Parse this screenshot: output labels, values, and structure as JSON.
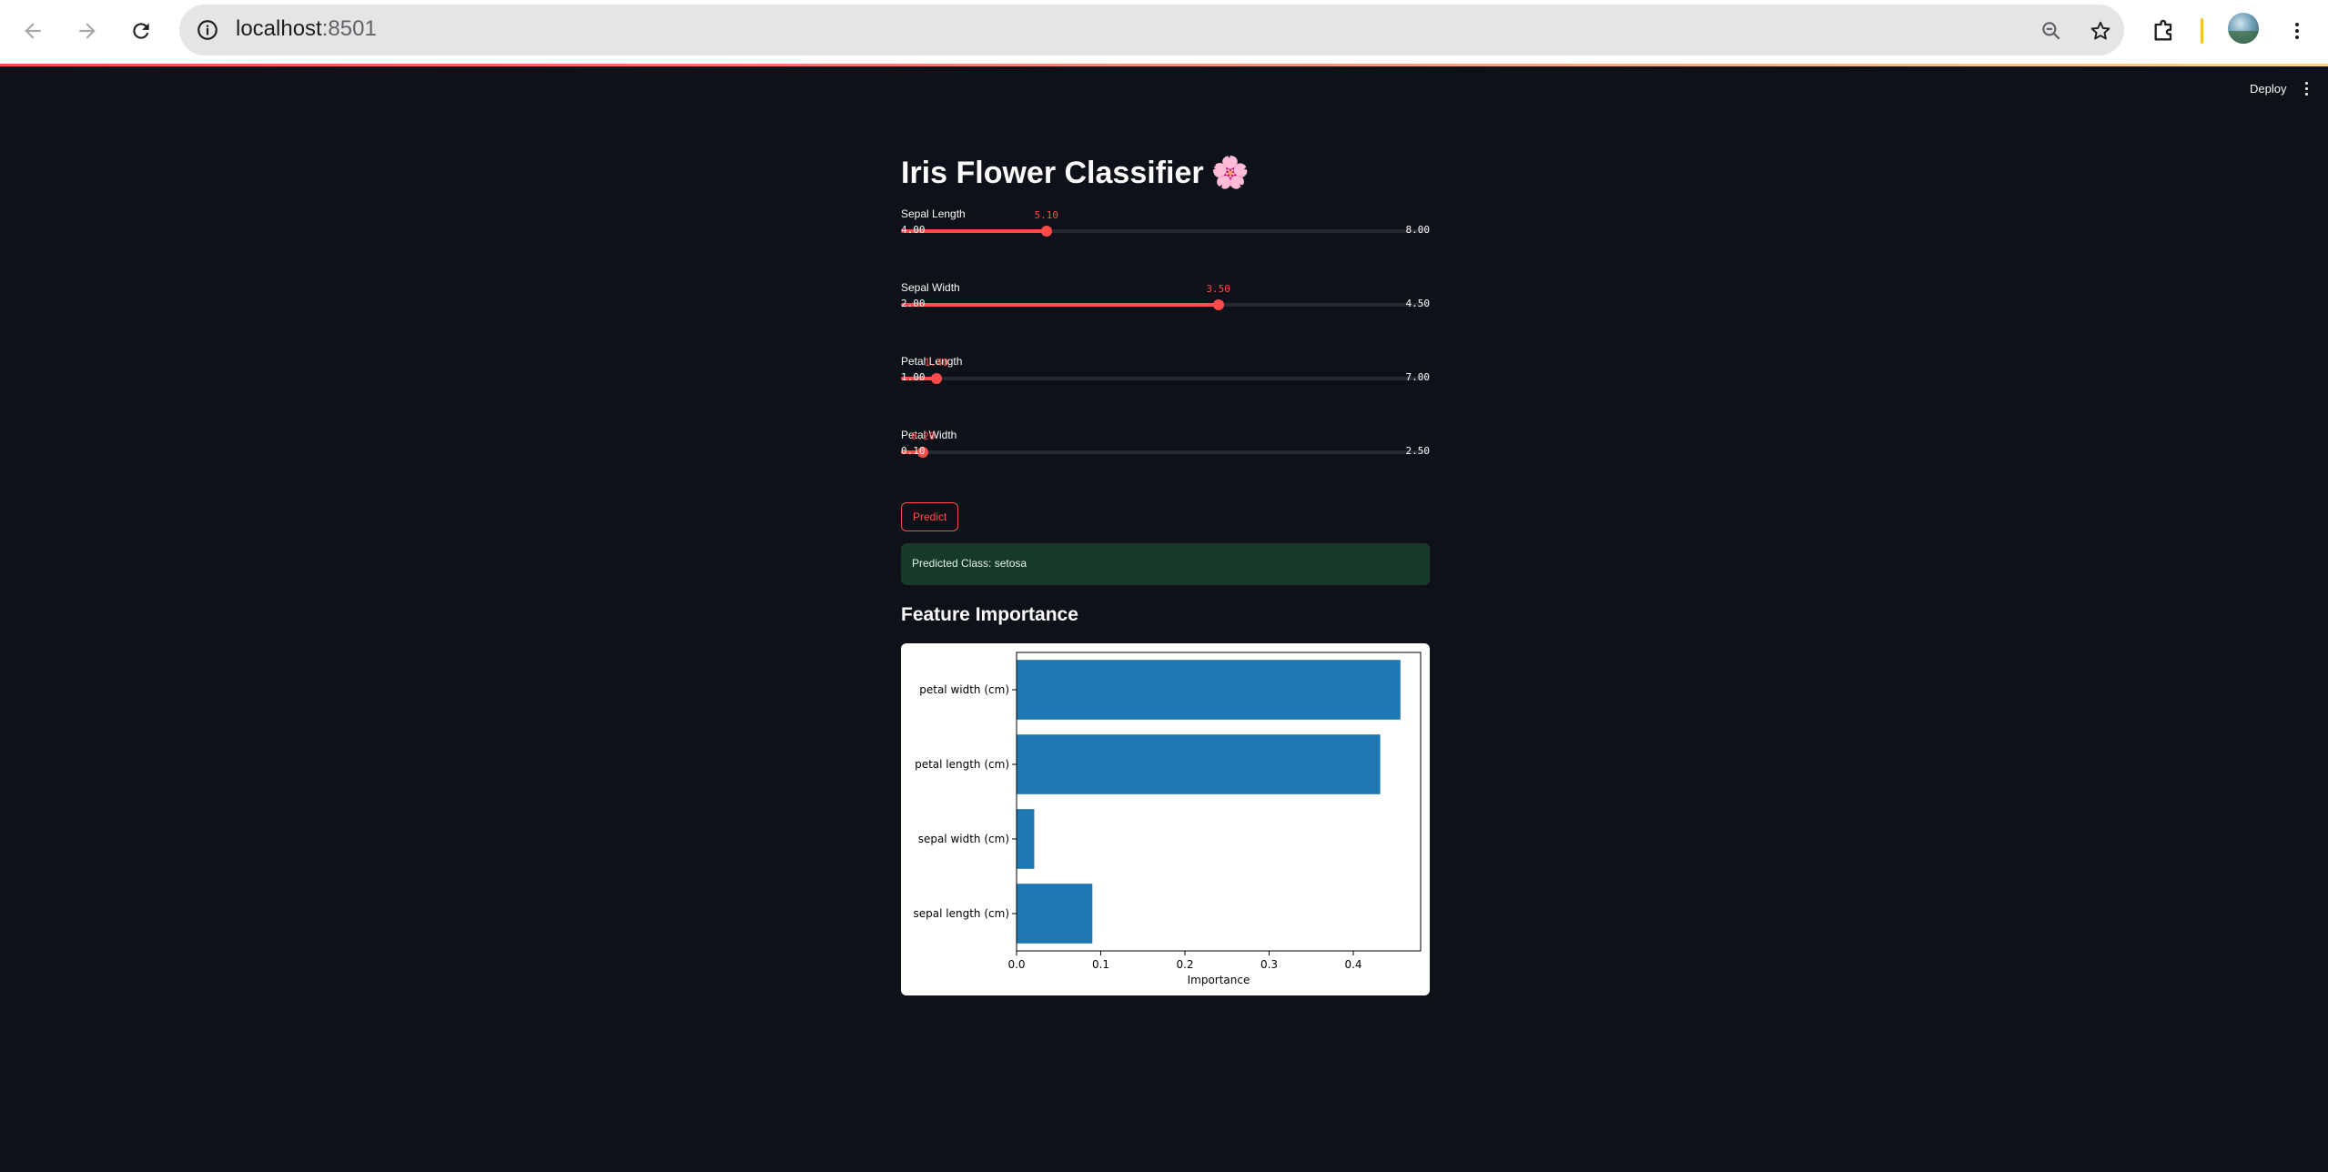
{
  "browser": {
    "url_host": "localhost",
    "url_port": ":8501",
    "icons": {
      "back": "arrow-left-icon",
      "forward": "arrow-right-icon",
      "reload": "reload-icon",
      "site_info": "info-icon",
      "zoom": "zoom-out-icon",
      "bookmark": "star-icon",
      "extensions": "puzzle-icon",
      "menu": "kebab-menu-icon"
    }
  },
  "streamlit_header": {
    "deploy_label": "Deploy"
  },
  "app": {
    "title": "Iris Flower Classifier",
    "title_emoji": "🌸",
    "accent_color": "#ff4b4b",
    "sliders": [
      {
        "label": "Sepal Length",
        "value": "5.10",
        "min": "4.00",
        "max": "8.00",
        "fraction": 0.275
      },
      {
        "label": "Sepal Width",
        "value": "3.50",
        "min": "2.00",
        "max": "4.50",
        "fraction": 0.6
      },
      {
        "label": "Petal Length",
        "value": "1.40",
        "min": "1.00",
        "max": "7.00",
        "fraction": 0.0667
      },
      {
        "label": "Petal Width",
        "value": "0.20",
        "min": "0.10",
        "max": "2.50",
        "fraction": 0.0417
      }
    ],
    "predict_label": "Predict",
    "prediction_text": "Predicted Class: setosa",
    "feature_importance_header": "Feature Importance"
  },
  "chart_data": {
    "type": "bar",
    "orientation": "horizontal",
    "categories": [
      "sepal length (cm)",
      "sepal width (cm)",
      "petal length (cm)",
      "petal width (cm)"
    ],
    "values": [
      0.09,
      0.021,
      0.432,
      0.456
    ],
    "xlabel": "Importance",
    "ylabel": "",
    "xlim": [
      0,
      0.48
    ],
    "xticks": [
      "0.0",
      "0.1",
      "0.2",
      "0.3",
      "0.4"
    ],
    "bar_color": "#1f77b4",
    "grid": false
  }
}
